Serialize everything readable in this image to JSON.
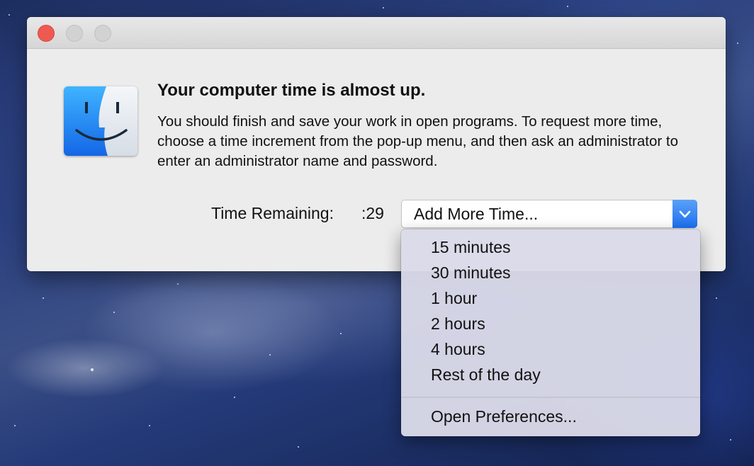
{
  "dialog": {
    "heading": "Your computer time is almost up.",
    "message": "You should finish and save your work in open programs. To request more time, choose a time increment from the pop-up menu, and then ask an administrator to enter an administrator name and password.",
    "time_remaining_label": "Time Remaining:",
    "time_remaining_value": ":29",
    "popup_selected": "Add More Time...",
    "icon": "finder-icon"
  },
  "menu": {
    "items": [
      "15 minutes",
      "30 minutes",
      "1 hour",
      "2 hours",
      "4 hours",
      "Rest of the day"
    ],
    "footer_item": "Open Preferences..."
  },
  "colors": {
    "close_button": "#ee5a52",
    "popup_accent": "#1d6ff0",
    "finder_blue": "#1a8cf0"
  }
}
